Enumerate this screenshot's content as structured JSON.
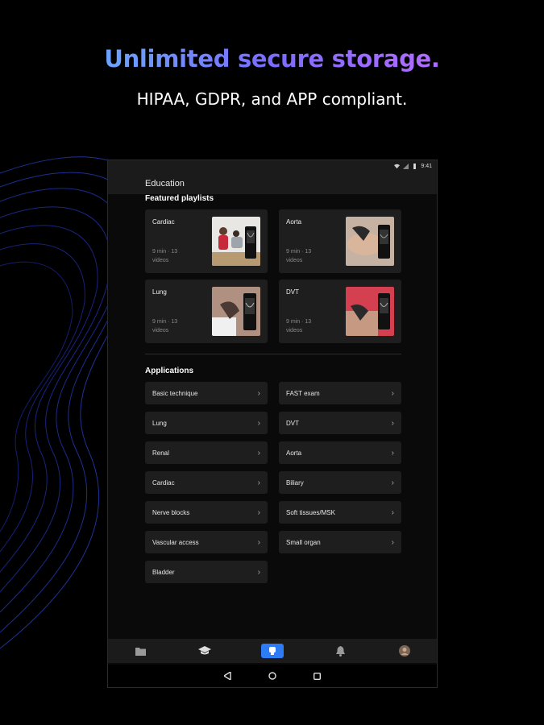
{
  "hero": {
    "headline": "Unlimited secure storage.",
    "subheadline": "HIPAA, GDPR, and APP compliant."
  },
  "status_bar": {
    "time": "9:41"
  },
  "app_bar": {
    "title": "Education"
  },
  "featured": {
    "title": "Featured playlists",
    "playlists": [
      {
        "title": "Cardiac",
        "meta": "9 min · 13 videos"
      },
      {
        "title": "Aorta",
        "meta": "9 min · 13 videos"
      },
      {
        "title": "Lung",
        "meta": "9 min · 13 videos"
      },
      {
        "title": "DVT",
        "meta": "9 min · 13 videos"
      }
    ]
  },
  "applications": {
    "title": "Applications",
    "items": [
      {
        "label": "Basic technique"
      },
      {
        "label": "FAST exam"
      },
      {
        "label": "Lung"
      },
      {
        "label": "DVT"
      },
      {
        "label": "Renal"
      },
      {
        "label": "Aorta"
      },
      {
        "label": "Cardiac"
      },
      {
        "label": "Biliary"
      },
      {
        "label": "Nerve blocks"
      },
      {
        "label": "Soft tissues/MSK"
      },
      {
        "label": "Vascular access"
      },
      {
        "label": "Small organ"
      },
      {
        "label": "Bladder"
      }
    ]
  },
  "bottom_nav": {
    "items": [
      {
        "icon": "folder-icon"
      },
      {
        "icon": "graduation-cap-icon"
      },
      {
        "icon": "probe-icon",
        "active": true
      },
      {
        "icon": "bell-icon"
      },
      {
        "icon": "avatar"
      }
    ]
  },
  "colors": {
    "accent": "#2d7cf6",
    "card": "#1e1e1e",
    "background": "#000000"
  }
}
